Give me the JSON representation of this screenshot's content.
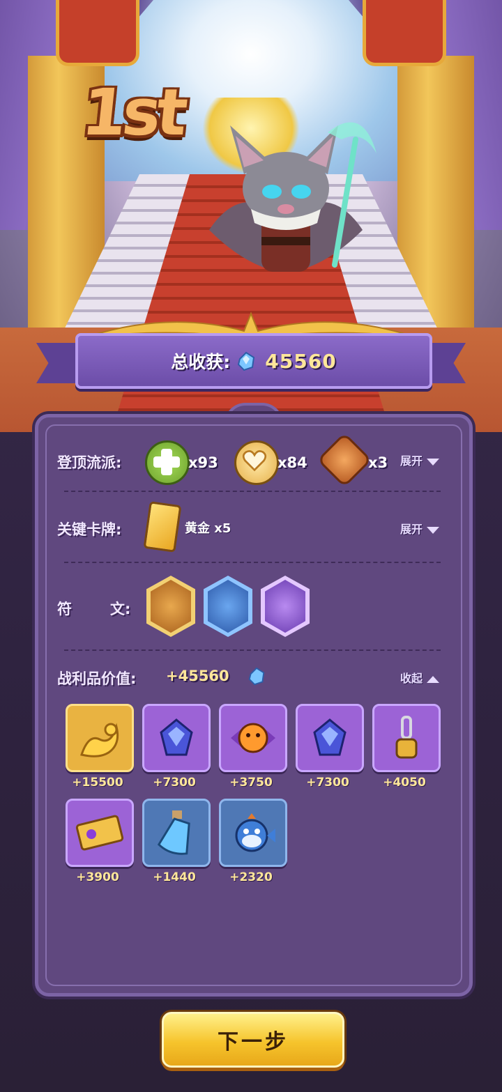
{
  "placement": "1st",
  "total": {
    "label": "总收获:",
    "value": "45560"
  },
  "build": {
    "label": "登顶流派:",
    "items": [
      {
        "icon": "green-cross-icon",
        "count": "x93",
        "color": "#8bc34a"
      },
      {
        "icon": "heart-icon",
        "count": "x84",
        "color": "#f0c060"
      },
      {
        "icon": "swirl-icon",
        "count": "x3",
        "color": "#d9803a"
      }
    ],
    "toggle": "展开"
  },
  "key_card": {
    "label": "关键卡牌:",
    "name": "黄金 x5",
    "toggle": "展开"
  },
  "runes": {
    "label_1": "符",
    "label_2": "文:",
    "items": [
      {
        "icon": "fire-rune-icon",
        "color": "#d08a30"
      },
      {
        "icon": "ice-rune-icon",
        "color": "#3f73c9"
      },
      {
        "icon": "moon-rune-icon",
        "color": "#9b6ad8"
      }
    ]
  },
  "loot": {
    "label": "战利品价值:",
    "value": "+45560",
    "toggle": "收起",
    "items": [
      {
        "icon": "golden-dragon-icon",
        "value": "+15500",
        "bg": "#e9b341"
      },
      {
        "icon": "sapphire-gem-icon",
        "value": "+7300",
        "bg": "#9c63d6"
      },
      {
        "icon": "pumpkin-candy-icon",
        "value": "+3750",
        "bg": "#9c63d6"
      },
      {
        "icon": "sapphire-gem-icon",
        "value": "+7300",
        "bg": "#9c63d6"
      },
      {
        "icon": "chain-lock-icon",
        "value": "+4050",
        "bg": "#9c63d6"
      },
      {
        "icon": "vip-ticket-icon",
        "value": "+3900",
        "bg": "#9c63d6"
      },
      {
        "icon": "potion-bottle-icon",
        "value": "+1440",
        "bg": "#4f78b5"
      },
      {
        "icon": "puffer-fish-icon",
        "value": "+2320",
        "bg": "#4f78b5"
      }
    ]
  },
  "next_button": "下一步"
}
